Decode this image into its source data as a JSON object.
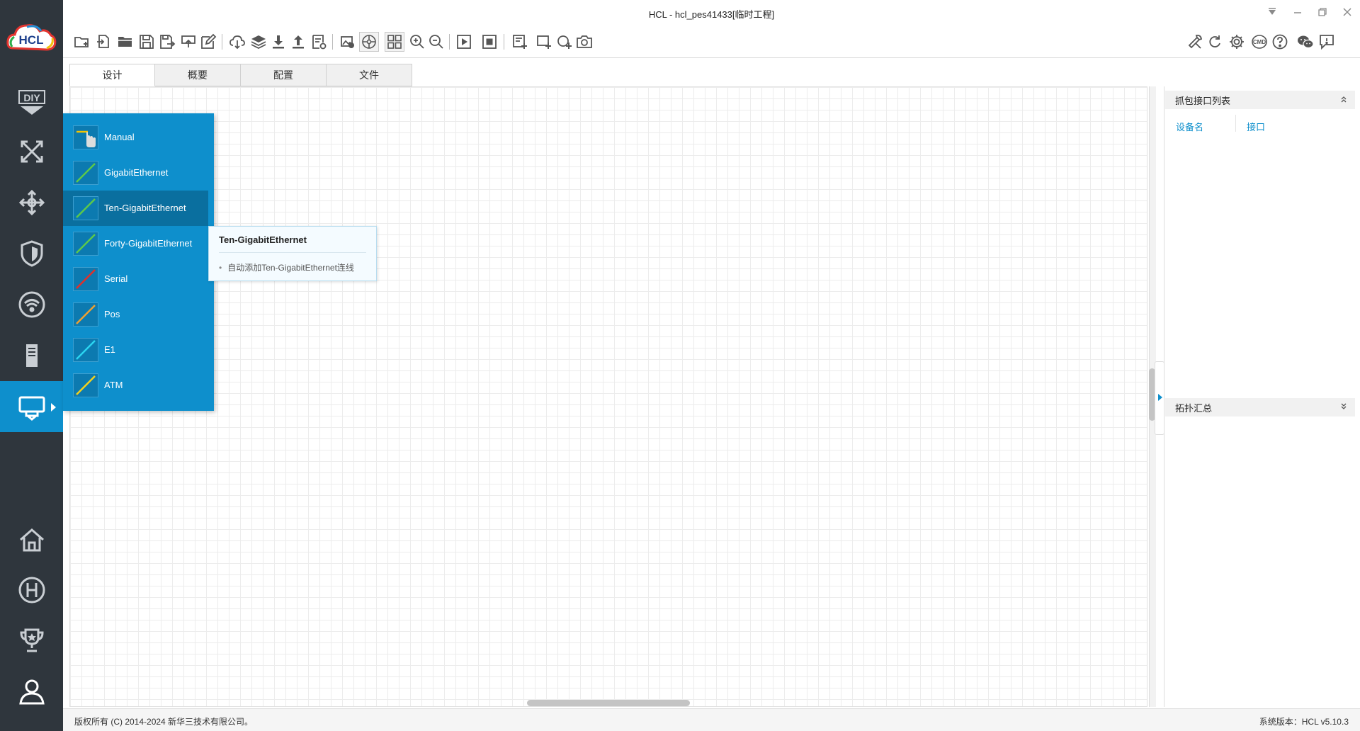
{
  "window": {
    "title": "HCL - hcl_pes41433[临时工程]"
  },
  "logo": {
    "text": "HCL"
  },
  "rail": {
    "items": [
      {
        "name": "diy",
        "icon": "diy-icon"
      },
      {
        "name": "router",
        "icon": "router-icon"
      },
      {
        "name": "switch",
        "icon": "switch-icon"
      },
      {
        "name": "firewall",
        "icon": "shield-icon"
      },
      {
        "name": "wireless",
        "icon": "wifi-icon"
      },
      {
        "name": "server",
        "icon": "server-icon"
      },
      {
        "name": "connection",
        "icon": "link-icon",
        "active": true
      }
    ],
    "bottom": [
      {
        "name": "home",
        "icon": "home-icon"
      },
      {
        "name": "h3c",
        "icon": "h-logo-icon"
      },
      {
        "name": "trophy",
        "icon": "trophy-icon"
      },
      {
        "name": "user",
        "icon": "user-icon"
      }
    ]
  },
  "tabs": [
    {
      "label": "设计"
    },
    {
      "label": "概要"
    },
    {
      "label": "配置"
    },
    {
      "label": "文件"
    }
  ],
  "right_panel": {
    "capture_title": "抓包接口列表",
    "col_device": "设备名",
    "col_interface": "接口",
    "topology_title": "拓扑汇总"
  },
  "link_menu": {
    "items": [
      {
        "label": "Manual",
        "color": "#f5c400"
      },
      {
        "label": "GigabitEthernet",
        "color": "#5cc94a"
      },
      {
        "label": "Ten-GigabitEthernet",
        "color": "#5cc94a"
      },
      {
        "label": "Forty-GigabitEthernet",
        "color": "#5cc94a"
      },
      {
        "label": "Serial",
        "color": "#e0302a"
      },
      {
        "label": "Pos",
        "color": "#f0a030"
      },
      {
        "label": "E1",
        "color": "#2ad4f0"
      },
      {
        "label": "ATM",
        "color": "#f5d21c"
      }
    ]
  },
  "tooltip": {
    "title": "Ten-GigabitEthernet",
    "desc": "自动添加Ten-GigabitEthernet连线"
  },
  "status": {
    "copyright": "版权所有 (C) 2014-2024 新华三技术有限公司。",
    "version": "系统版本：HCL v5.10.3"
  },
  "colors": {
    "rail_bg": "#2f363d",
    "accent": "#0e8fcc",
    "menu_hover": "#0a6f9f"
  }
}
